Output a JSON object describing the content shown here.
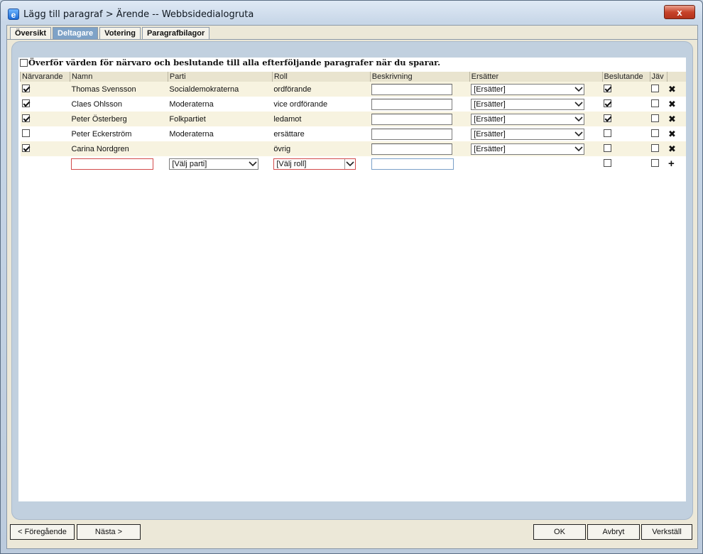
{
  "window": {
    "title": "Lägg till paragraf > Ärende -- Webbsidedialogruta",
    "close": "x"
  },
  "tabs": [
    "Översikt",
    "Deltagare",
    "Votering",
    "Paragrafbilagor"
  ],
  "active_tab": "Deltagare",
  "transfer_label": "Överför värden för närvaro och beslutande till alla efterföljande paragrafer när du sparar.",
  "columns": [
    "Närvarande",
    "Namn",
    "Parti",
    "Roll",
    "Beskrivning",
    "Ersätter",
    "Beslutande",
    "Jäv"
  ],
  "rows": [
    {
      "present": true,
      "name": "Thomas Svensson",
      "party": "Socialdemokraterna",
      "role": "ordförande",
      "replaces": "[Ersätter]",
      "deciding": true,
      "jav": false
    },
    {
      "present": true,
      "name": "Claes Ohlsson",
      "party": "Moderaterna",
      "role": "vice ordförande",
      "replaces": "[Ersätter]",
      "deciding": true,
      "jav": false
    },
    {
      "present": true,
      "name": "Peter Österberg",
      "party": "Folkpartiet",
      "role": "ledamot",
      "replaces": "[Ersätter]",
      "deciding": true,
      "jav": false
    },
    {
      "present": false,
      "name": "Peter Eckerström",
      "party": "Moderaterna",
      "role": "ersättare",
      "replaces": "[Ersätter]",
      "deciding": false,
      "jav": false
    },
    {
      "present": true,
      "name": "Carina Nordgren",
      "party": "",
      "role": "övrig",
      "replaces": "[Ersätter]",
      "deciding": false,
      "jav": false
    }
  ],
  "new_row": {
    "party_select": "[Välj parti]",
    "role_select": "[Välj roll]"
  },
  "icons": {
    "remove": "✖",
    "add": "+"
  },
  "buttons": {
    "previous": "< Föregående",
    "next": "Nästa >",
    "ok": "OK",
    "cancel": "Avbryt",
    "apply": "Verkställ"
  }
}
